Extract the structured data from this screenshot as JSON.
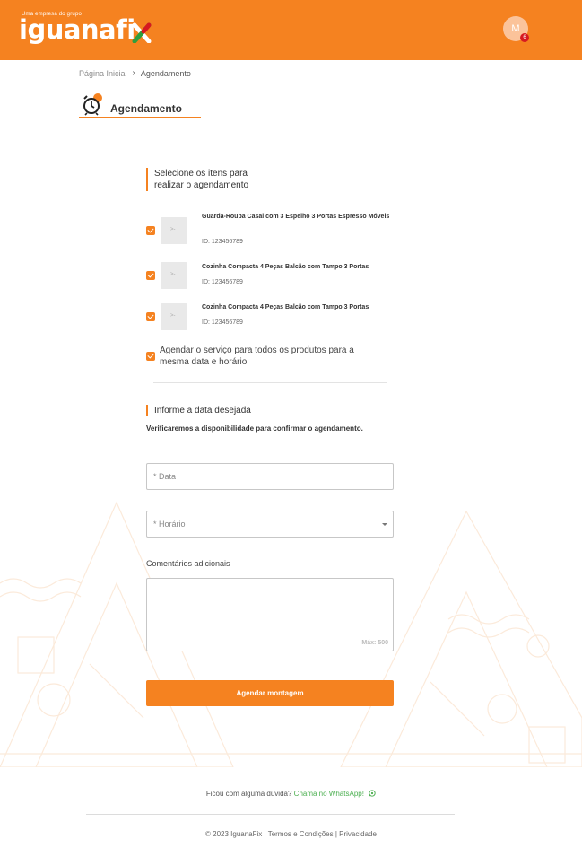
{
  "header": {
    "tagline": "Uma empresa do grupo",
    "logo_text": "iguanafi",
    "logo_x": "x",
    "avatar_initial": "M",
    "notification_count": "6",
    "brand_color": "#f58220"
  },
  "breadcrumb": {
    "home": "Página Inicial",
    "separator": "›",
    "current": "Agendamento"
  },
  "page": {
    "title": "Agendamento"
  },
  "items_section": {
    "label_line1": "Selecione os itens para",
    "label_line2": "realizar o agendamento",
    "items": [
      {
        "name": "Guarda-Roupa Casal com 3 Espelho 3 Portas Espresso Móveis",
        "id": "ID: 123456789",
        "checked": true
      },
      {
        "name": "Cozinha Compacta 4 Peças Balcão com Tampo 3 Portas",
        "id": "ID: 123456789",
        "checked": true
      },
      {
        "name": "Cozinha Compacta 4 Peças Balcão com Tampo 3 Portas",
        "id": "ID: 123456789",
        "checked": true
      }
    ],
    "schedule_all_label": "Agendar o serviço para todos os produtos para a mesma data e horário",
    "schedule_all_checked": true
  },
  "date_section": {
    "label": "Informe a data desejada",
    "help": "Verificaremos a disponibilidade para confirmar o agendamento.",
    "date_placeholder": "* Data",
    "time_placeholder": "* Horário",
    "comments_label": "Comentários adicionais",
    "comments_counter": "Máx: 500",
    "submit_label": "Agendar montagem"
  },
  "footer": {
    "help_question": "Ficou com alguma dúvida?",
    "whatsapp_link": "Chama no WhatsApp!",
    "copyright": "© 2023 IguanaFix",
    "sep": "|",
    "terms": "Termos e Condições",
    "privacy": "Privacidade"
  }
}
